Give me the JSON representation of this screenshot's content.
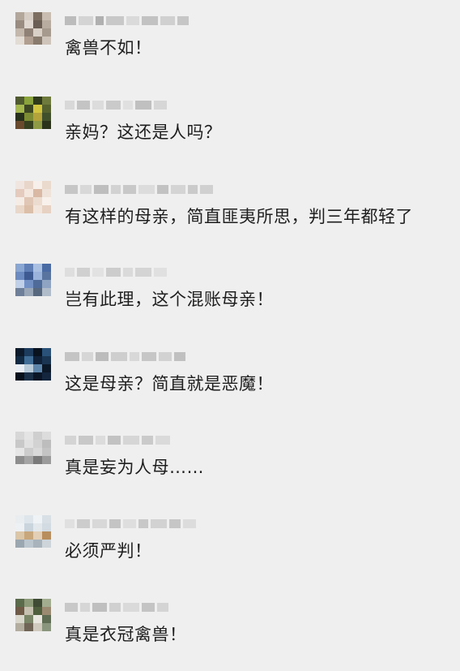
{
  "comments": [
    {
      "text": "禽兽不如！"
    },
    {
      "text": "亲妈？这还是人吗？"
    },
    {
      "text": "有这样的母亲，简直匪夷所思，判三年都轻了"
    },
    {
      "text": "岂有此理，这个混账母亲！"
    },
    {
      "text": "这是母亲？简直就是恶魔！"
    },
    {
      "text": "真是妄为人母……"
    },
    {
      "text": "必须严判！"
    },
    {
      "text": "真是衣冠禽兽！"
    }
  ],
  "colors": {
    "background": "#efefef",
    "comment_text": "#1e1e1e",
    "nickname_mosaic": "#c9c9c9"
  },
  "avatars": [
    {
      "pixels": [
        "#b3a79b",
        "#d6cdc4",
        "#7d6e62",
        "#c9bdb1",
        "#9a8c80",
        "#e0d8d0",
        "#6b5f55",
        "#b8aca0",
        "#c4b8ac",
        "#8f8176",
        "#d9d0c7",
        "#a69a8e",
        "#e3dcd5",
        "#b09f91",
        "#8a7b6f",
        "#cfc4b9"
      ]
    },
    {
      "pixels": [
        "#4f5b2e",
        "#8aa33c",
        "#2f3a1c",
        "#6e7a3b",
        "#a5b850",
        "#3c4722",
        "#d1c43e",
        "#55622d",
        "#26301a",
        "#7b8c35",
        "#b4a23a",
        "#40502a",
        "#6a4a2c",
        "#36401f",
        "#8e9a44",
        "#2a321a"
      ]
    },
    {
      "pixels": [
        "#f1e6df",
        "#e8d6cb",
        "#f7efe9",
        "#ead9cd",
        "#e4cbbd",
        "#f3e7de",
        "#d9b9a3",
        "#efe2d8",
        "#f5ece5",
        "#e0c6b4",
        "#ecdcd0",
        "#f8f1eb",
        "#e9d7ca",
        "#dcbfa9",
        "#f2e5dc",
        "#e6d1c3"
      ]
    },
    {
      "pixels": [
        "#8aa7d4",
        "#5f7fb6",
        "#a9c0e2",
        "#4a6aa3",
        "#6c8bc0",
        "#3d5a92",
        "#9ab3da",
        "#58749f",
        "#c0d0e8",
        "#7390c4",
        "#4e6b9a",
        "#8fa3c2",
        "#6d7f99",
        "#9aa7b8",
        "#57687f",
        "#b1bccb"
      ]
    },
    {
      "pixels": [
        "#0c1a2c",
        "#1d3b5c",
        "#09121f",
        "#2a5178",
        "#122a44",
        "#3f6d96",
        "#0f223a",
        "#1a3552",
        "#e8eef4",
        "#b9cad9",
        "#5e86ab",
        "#0b1828",
        "#07101b",
        "#1b2f47",
        "#0a1625",
        "#13263e"
      ]
    },
    {
      "pixels": [
        "#d7d7d7",
        "#e4e4e4",
        "#cfcfcf",
        "#dcdcdc",
        "#c8c8c8",
        "#e0e0e0",
        "#d2d2d2",
        "#bdbdbd",
        "#e6e6e6",
        "#cccccc",
        "#d9d9d9",
        "#c4c4c4",
        "#8d8d8d",
        "#a4a4a4",
        "#7a7a7a",
        "#9b9b9b"
      ]
    },
    {
      "pixels": [
        "#e9edf0",
        "#dfe6eb",
        "#f0f3f5",
        "#d8e0e6",
        "#eef1f3",
        "#c9d4dc",
        "#e3e8ec",
        "#d2dbe2",
        "#dcc6a8",
        "#c9a77c",
        "#e2cfb6",
        "#b98e5e",
        "#9aa6b0",
        "#bcc6ce",
        "#a8b3bc",
        "#cdd5db"
      ]
    },
    {
      "pixels": [
        "#5a6b4b",
        "#8c9a7a",
        "#3f4b34",
        "#a2ad90",
        "#6e5a46",
        "#c6c0b0",
        "#4f5f3e",
        "#9b8a72",
        "#d9d6cc",
        "#7a8466",
        "#e8e6df",
        "#5d6c52",
        "#b3ada0",
        "#6f6455",
        "#cfcabd",
        "#8a957d"
      ]
    }
  ],
  "nicknames": [
    {
      "blocks": [
        {
          "w": 14,
          "c": "#bcbcbc"
        },
        {
          "w": 18,
          "c": "#d4d4d4"
        },
        {
          "w": 10,
          "c": "#b0b0b0"
        },
        {
          "w": 22,
          "c": "#c8c8c8"
        },
        {
          "w": 16,
          "c": "#dadada"
        },
        {
          "w": 20,
          "c": "#c2c2c2"
        },
        {
          "w": 18,
          "c": "#d0d0d0"
        },
        {
          "w": 14,
          "c": "#c6c6c6"
        }
      ]
    },
    {
      "blocks": [
        {
          "w": 12,
          "c": "#d8d8d8"
        },
        {
          "w": 16,
          "c": "#c4c4c4"
        },
        {
          "w": 14,
          "c": "#dcdcdc"
        },
        {
          "w": 18,
          "c": "#cacaca"
        },
        {
          "w": 12,
          "c": "#e0e0e0"
        },
        {
          "w": 20,
          "c": "#c0c0c0"
        },
        {
          "w": 16,
          "c": "#d6d6d6"
        }
      ]
    },
    {
      "blocks": [
        {
          "w": 16,
          "c": "#c6c6c6"
        },
        {
          "w": 14,
          "c": "#d8d8d8"
        },
        {
          "w": 18,
          "c": "#bebebe"
        },
        {
          "w": 12,
          "c": "#d2d2d2"
        },
        {
          "w": 16,
          "c": "#c8c8c8"
        },
        {
          "w": 20,
          "c": "#dcdcdc"
        },
        {
          "w": 14,
          "c": "#c2c2c2"
        },
        {
          "w": 18,
          "c": "#d4d4d4"
        },
        {
          "w": 12,
          "c": "#cacaca"
        },
        {
          "w": 16,
          "c": "#d0d0d0"
        }
      ]
    },
    {
      "blocks": [
        {
          "w": 12,
          "c": "#dedede"
        },
        {
          "w": 16,
          "c": "#d0d0d0"
        },
        {
          "w": 14,
          "c": "#e2e2e2"
        },
        {
          "w": 18,
          "c": "#cccccc"
        },
        {
          "w": 12,
          "c": "#dadada"
        },
        {
          "w": 20,
          "c": "#d4d4d4"
        },
        {
          "w": 16,
          "c": "#e0e0e0"
        }
      ]
    },
    {
      "blocks": [
        {
          "w": 18,
          "c": "#c4c4c4"
        },
        {
          "w": 14,
          "c": "#d6d6d6"
        },
        {
          "w": 16,
          "c": "#bcbcbc"
        },
        {
          "w": 20,
          "c": "#cecece"
        },
        {
          "w": 12,
          "c": "#d8d8d8"
        },
        {
          "w": 18,
          "c": "#c6c6c6"
        },
        {
          "w": 16,
          "c": "#d2d2d2"
        },
        {
          "w": 14,
          "c": "#c0c0c0"
        }
      ]
    },
    {
      "blocks": [
        {
          "w": 14,
          "c": "#d4d4d4"
        },
        {
          "w": 18,
          "c": "#c8c8c8"
        },
        {
          "w": 12,
          "c": "#dcdcdc"
        },
        {
          "w": 16,
          "c": "#c2c2c2"
        },
        {
          "w": 20,
          "c": "#d6d6d6"
        },
        {
          "w": 14,
          "c": "#cacaca"
        },
        {
          "w": 18,
          "c": "#dadada"
        }
      ]
    },
    {
      "blocks": [
        {
          "w": 12,
          "c": "#e0e0e0"
        },
        {
          "w": 16,
          "c": "#cccccc"
        },
        {
          "w": 18,
          "c": "#d8d8d8"
        },
        {
          "w": 14,
          "c": "#c4c4c4"
        },
        {
          "w": 16,
          "c": "#dedede"
        },
        {
          "w": 12,
          "c": "#c8c8c8"
        },
        {
          "w": 20,
          "c": "#d2d2d2"
        },
        {
          "w": 14,
          "c": "#c6c6c6"
        },
        {
          "w": 16,
          "c": "#dcdcdc"
        }
      ]
    },
    {
      "blocks": [
        {
          "w": 16,
          "c": "#c8c8c8"
        },
        {
          "w": 12,
          "c": "#d6d6d6"
        },
        {
          "w": 18,
          "c": "#bfbfbf"
        },
        {
          "w": 14,
          "c": "#d0d0d0"
        },
        {
          "w": 20,
          "c": "#dadada"
        },
        {
          "w": 16,
          "c": "#c4c4c4"
        },
        {
          "w": 14,
          "c": "#d4d4d4"
        }
      ]
    }
  ]
}
